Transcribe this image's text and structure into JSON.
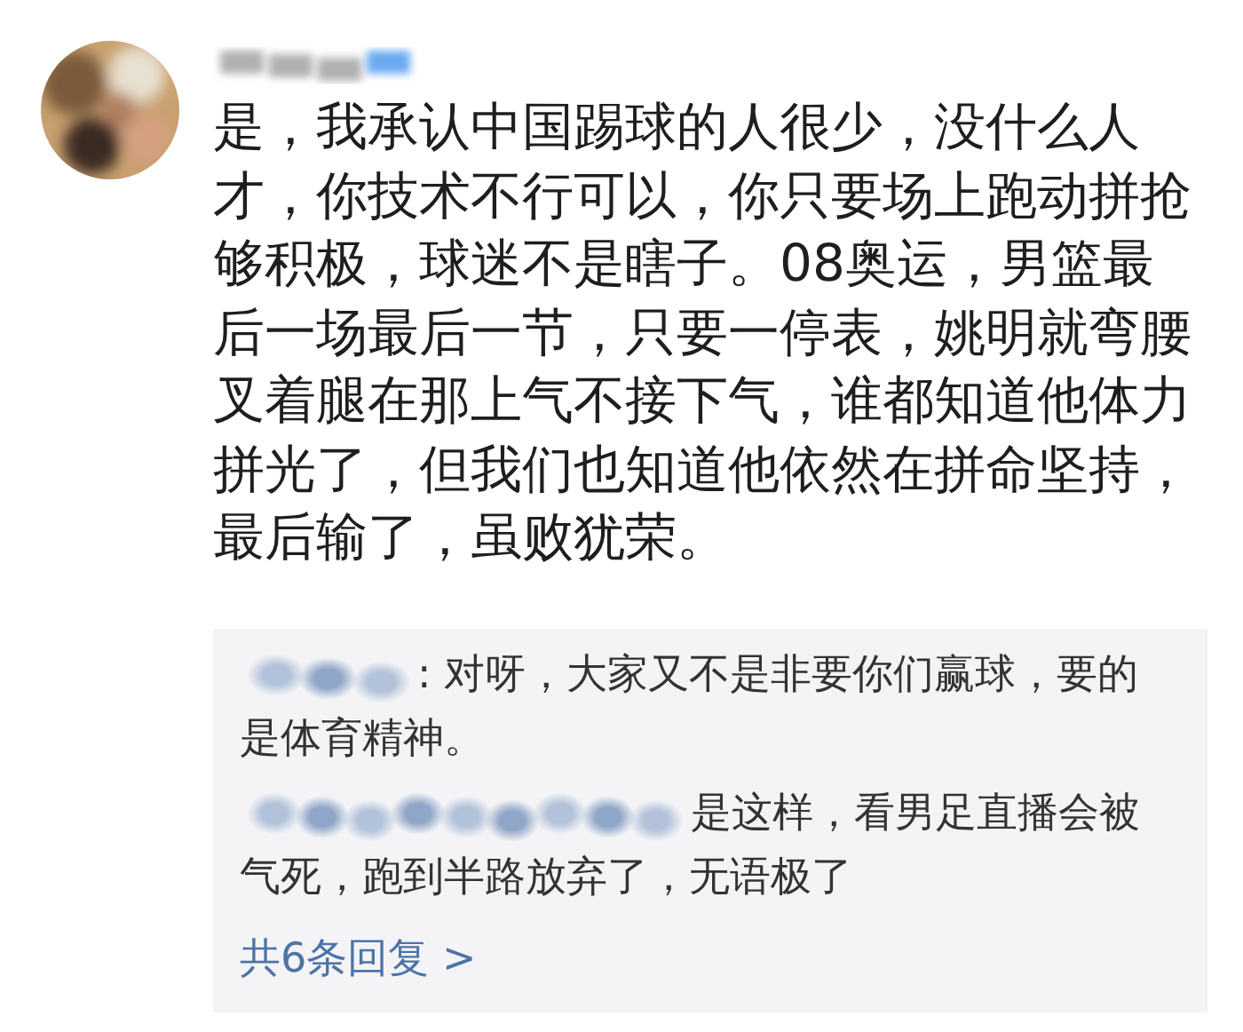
{
  "comment": {
    "text": "是，我承认中国踢球的人很少，没什么人才，你技术不行可以，你只要场上跑动拼抢够积极，球迷不是瞎子。08奥运，男篮最后一场最后一节，只要一停表，姚明就弯腰叉着腿在那上气不接下气，谁都知道他体力拼光了，但我们也知道他依然在拼命坚持，最后输了，虽败犹荣。"
  },
  "replies": [
    {
      "text": ": 对呀，大家又不是非要你们赢球，要的是体育精神。"
    },
    {
      "text": "是这样，看男足直播会被气死，跑到半路放弃了，无语极了"
    }
  ],
  "more_replies": "共6条回复 >"
}
